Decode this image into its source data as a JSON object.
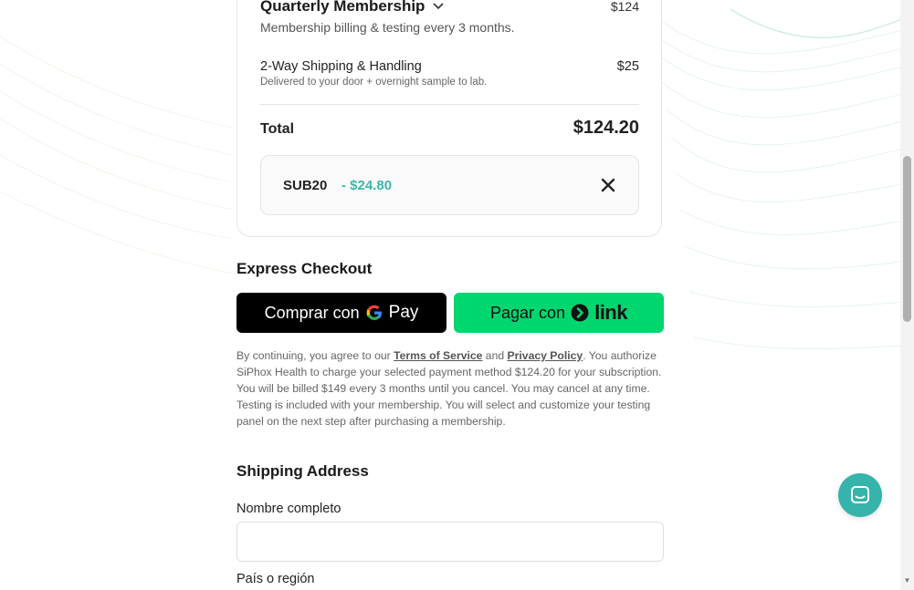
{
  "summary": {
    "plan_title": "Quarterly Membership",
    "plan_price": "$124",
    "plan_description": "Membership billing & testing every 3 months.",
    "shipping_title": "2-Way Shipping & Handling",
    "shipping_price": "$25",
    "shipping_description": "Delivered to your door + overnight sample to lab.",
    "total_label": "Total",
    "total_amount": "$124.20",
    "coupon": {
      "code": "SUB20",
      "discount": "- $24.80"
    }
  },
  "express": {
    "title": "Express Checkout",
    "gpay_prefix": "Comprar con",
    "gpay_word": "Pay",
    "link_prefix": "Pagar con",
    "link_word": "link"
  },
  "legal": {
    "part1": "By continuing, you agree to our ",
    "terms": "Terms of Service",
    "and": " and ",
    "privacy": "Privacy Policy",
    "part2": ". You authorize SiPhox Health to charge your selected payment method $124.20 for your subscription. You will be billed $149 every 3 months until you cancel. You may cancel at any time. Testing is included with your membership. You will select and customize your testing panel on the next step after purchasing a membership."
  },
  "shipping": {
    "title": "Shipping Address",
    "name_label": "Nombre completo",
    "name_value": "",
    "country_label": "País o región"
  },
  "colors": {
    "accent_teal": "#36b3ab",
    "discount": "#3bb6a8",
    "link_green": "#00d66f",
    "gpay_black": "#000000"
  },
  "icons": {
    "plan_dropdown": "chevron-down-icon",
    "coupon_remove": "close-icon",
    "gpay": "google-g-icon",
    "link": "link-arrow-icon",
    "chat": "chat-icon"
  }
}
